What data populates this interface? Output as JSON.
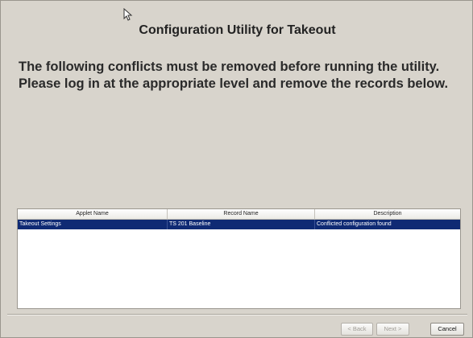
{
  "dialog": {
    "title": "Configuration Utility for Takeout",
    "message_line1": "The following conflicts must be removed before running the utility.",
    "message_line2": "Please log in at the appropriate level and remove the records below."
  },
  "table": {
    "columns": [
      "Applet Name",
      "Record Name",
      "Description"
    ],
    "rows": [
      [
        "Takeout Settings",
        "TS 201 Baseline",
        "Conflicted configuration found"
      ]
    ],
    "selected_row_color": "#0f2a74"
  },
  "buttons": {
    "back_label": "< Back",
    "next_label": "Next >",
    "cancel_label": "Cancel"
  },
  "icons": {
    "cursor": "mouse-pointer-icon"
  }
}
